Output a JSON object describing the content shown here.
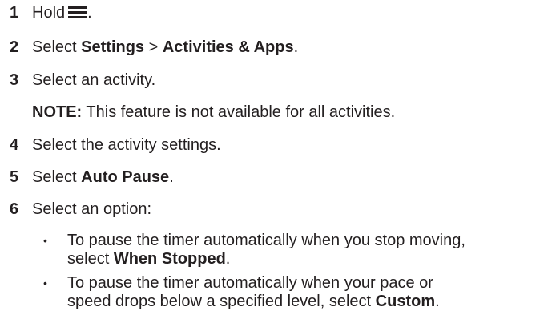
{
  "steps": [
    {
      "number": "1",
      "text": "Hold",
      "icon": "menu-icon",
      "suffix": "."
    },
    {
      "number": "2",
      "prefix": "Select ",
      "bold1": "Settings",
      "sep": " > ",
      "bold2": "Activities & Apps",
      "suffix": "."
    },
    {
      "number": "3",
      "text": "Select an activity."
    },
    {
      "number": "4",
      "text": "Select the activity settings."
    },
    {
      "number": "5",
      "prefix": "Select ",
      "bold1": "Auto Pause",
      "suffix": "."
    },
    {
      "number": "6",
      "text": "Select an option:"
    }
  ],
  "note": {
    "label": "NOTE:",
    "text": " This feature is not available for all activities."
  },
  "options": [
    {
      "bullet": "•",
      "line1": "To pause the timer automatically when you stop moving,",
      "line2_prefix": "select ",
      "line2_bold": "When Stopped",
      "line2_suffix": "."
    },
    {
      "bullet": "•",
      "line1": "To pause the timer automatically when your pace or",
      "line2_prefix": "speed drops below a specified level, select ",
      "line2_bold": "Custom",
      "line2_suffix": "."
    }
  ]
}
